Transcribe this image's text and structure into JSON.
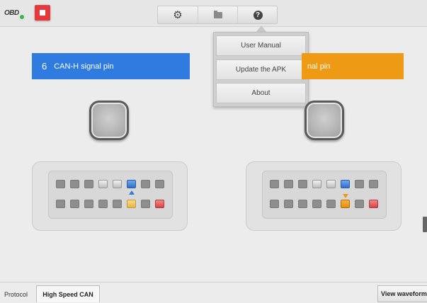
{
  "topbar": {
    "logo_text": "OBD",
    "stop_icon": "stop-icon",
    "tools": [
      "gear-icon",
      "folder-icon",
      "help-icon"
    ]
  },
  "menu": {
    "items": [
      "User Manual",
      "Update the APK",
      "About"
    ]
  },
  "panels": {
    "left": {
      "pin_number": "6",
      "title": "CAN-H signal pin",
      "color": "#2f7be0"
    },
    "right": {
      "title": "nal pin",
      "color": "#ee9a15"
    }
  },
  "bottombar": {
    "protocol_label": "Protocol",
    "protocol_value": "High Speed CAN",
    "view_waveform": "View waveform"
  }
}
